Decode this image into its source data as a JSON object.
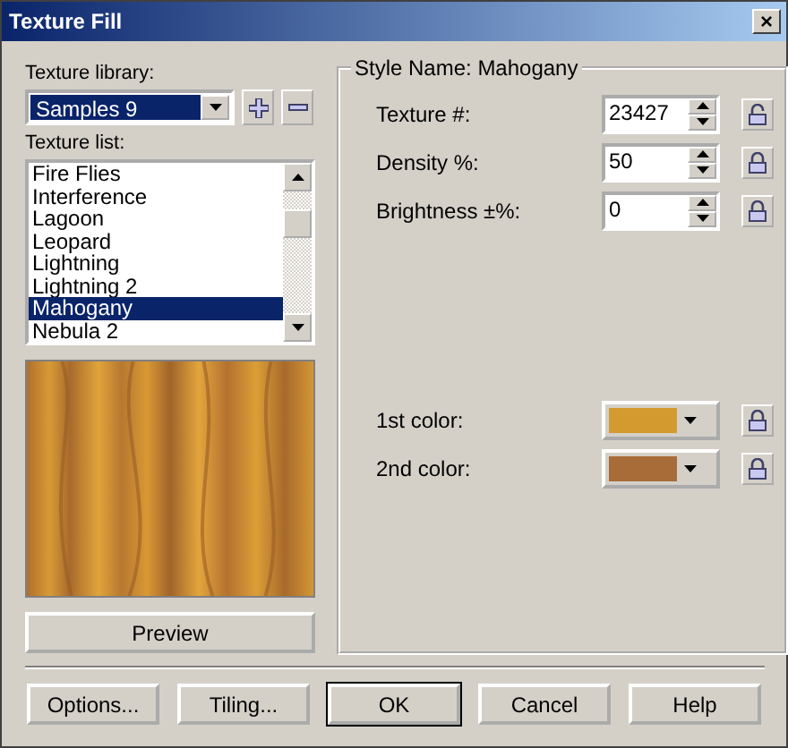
{
  "window": {
    "title": "Texture Fill",
    "close_label": "×"
  },
  "library": {
    "label": "Texture library:",
    "value": "Samples 9"
  },
  "texture_list": {
    "label": "Texture list:",
    "items": [
      {
        "label": "Fire Flies",
        "selected": false
      },
      {
        "label": "Interference",
        "selected": false
      },
      {
        "label": "Lagoon",
        "selected": false
      },
      {
        "label": "Leopard",
        "selected": false
      },
      {
        "label": "Lightning",
        "selected": false
      },
      {
        "label": "Lightning 2",
        "selected": false
      },
      {
        "label": "Mahogany",
        "selected": true
      },
      {
        "label": "Nebula 2",
        "selected": false
      }
    ]
  },
  "preview_button": "Preview",
  "style_group": {
    "title": "Style Name: Mahogany",
    "params": [
      {
        "label": "Texture #:",
        "value": "23427",
        "locked": false
      },
      {
        "label": "Density %:",
        "value": "50",
        "locked": true
      },
      {
        "label": "Brightness ±%:",
        "value": "0",
        "locked": true
      }
    ],
    "colors": [
      {
        "label": "1st color:",
        "color": "#d39a30",
        "locked": true
      },
      {
        "label": "2nd color:",
        "color": "#a86c38",
        "locked": true
      }
    ]
  },
  "buttons": [
    "Options...",
    "Tiling...",
    "OK",
    "Cancel",
    "Help"
  ]
}
